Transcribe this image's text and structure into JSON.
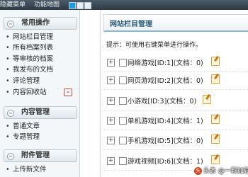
{
  "topbar": {
    "hide_menu": "隐藏菜单",
    "func_map": "功能地图"
  },
  "sidebar": {
    "sections": [
      {
        "title": "常用操作",
        "items": [
          {
            "label": "网站栏目管理"
          },
          {
            "label": "所有档案列表"
          },
          {
            "label": "等审核的档案"
          },
          {
            "label": "我发布的文档"
          },
          {
            "label": "评论管理"
          },
          {
            "label": "内容回收站"
          }
        ]
      },
      {
        "title": "内容管理",
        "items": [
          {
            "label": "普通文章"
          },
          {
            "label": "专题管理"
          }
        ]
      },
      {
        "title": "附件管理",
        "items": [
          {
            "label": "上传新文件"
          }
        ]
      }
    ]
  },
  "main": {
    "title": "网站栏目管理",
    "hint": "提示：可使用右键菜单进行操作。",
    "rows": [
      {
        "name": "网络游戏[ID:1](文档：0)"
      },
      {
        "name": "网页游戏[ID:2](文档：0)"
      },
      {
        "name": "小游戏[ID:3](文档：0)"
      },
      {
        "name": "单机游戏[ID:4](文档：1)"
      },
      {
        "name": "手机游戏[ID:5](文档：0)"
      },
      {
        "name": "游戏视频[ID:6](文档：1)"
      }
    ]
  },
  "watermark": {
    "text": "头条 @一颗加豆"
  }
}
